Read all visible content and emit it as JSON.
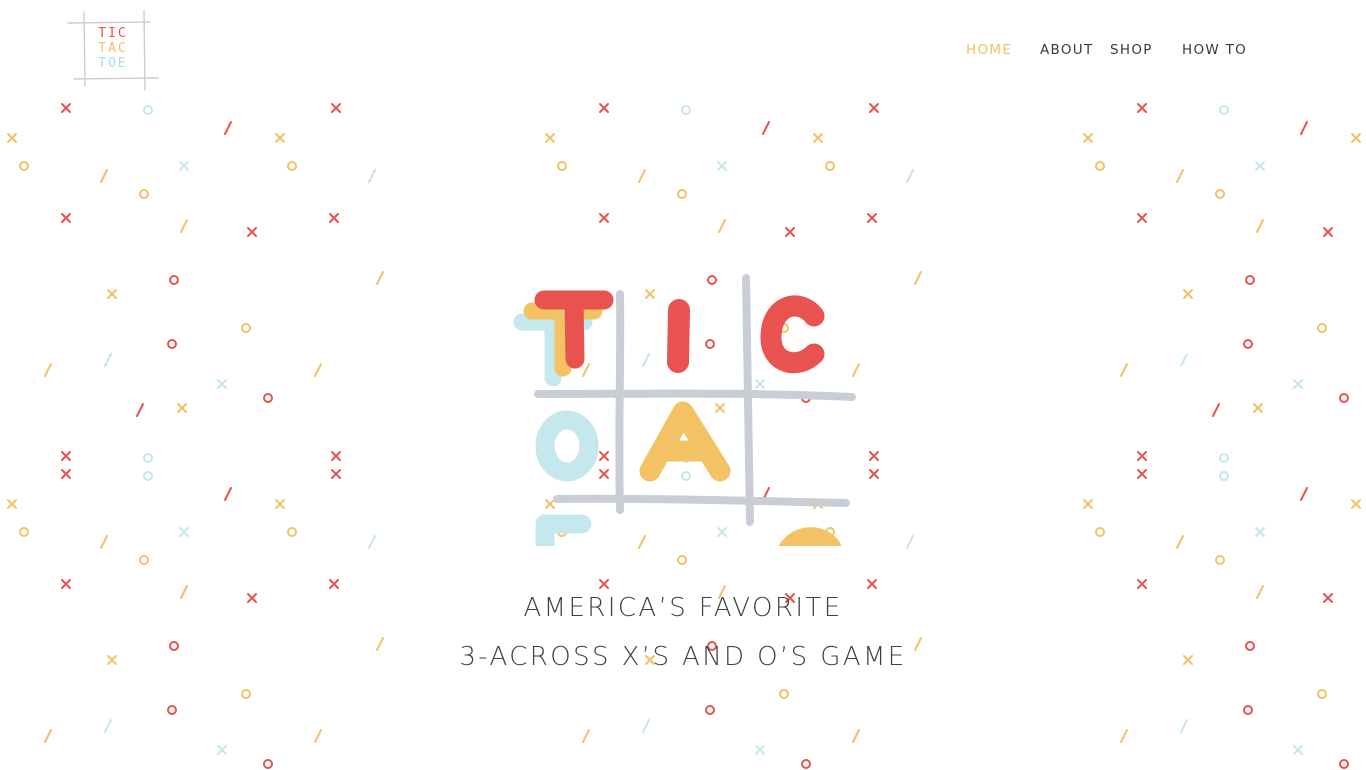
{
  "site": {
    "logo": {
      "lines": [
        "TIC",
        "TAC",
        "TOE"
      ],
      "colors": [
        "#e8524f",
        "#f2c265",
        "#c4e8ee"
      ],
      "frame_color": "#c9ced6"
    }
  },
  "nav": {
    "items": [
      {
        "label": "HOME",
        "active": true
      },
      {
        "label": "ABOUT",
        "active": false
      },
      {
        "label": "SHOP",
        "active": false
      },
      {
        "label": "HOW TO",
        "active": false
      }
    ]
  },
  "hero": {
    "logo_letters": {
      "row1": [
        "T",
        "I",
        "C"
      ],
      "row2": [
        "O",
        "A"
      ],
      "row3": [
        "E",
        "C"
      ]
    },
    "tagline": {
      "line1": "AMERICA’S FAVORITE",
      "line2": "3-ACROSS X’S AND O’S GAME"
    }
  },
  "colors": {
    "red": "#e8524f",
    "yellow": "#f2c265",
    "blue": "#c4e8ee",
    "grid": "#c9ced6",
    "nav_active": "#f2c265",
    "nav_text": "#3a3a3a",
    "tagline_text": "#3f3f45"
  }
}
